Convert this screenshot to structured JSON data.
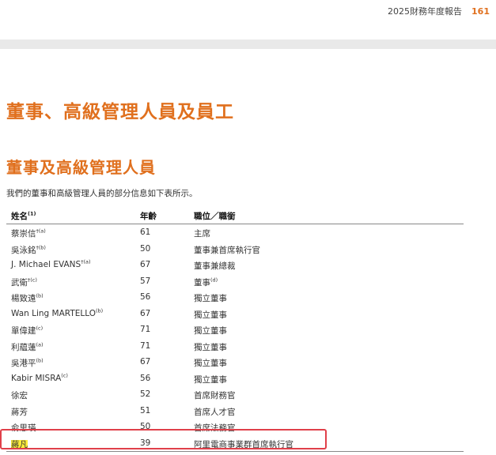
{
  "header": {
    "report_title": "2025財務年度報告",
    "page_number": "161"
  },
  "section_title": "董事、高級管理人員及員工",
  "subsection_title": "董事及高級管理人員",
  "intro_text": "我們的董事和高級管理人員的部分信息如下表所示。",
  "table": {
    "headers": {
      "name": "姓名",
      "name_note": "(1)",
      "age": "年齡",
      "position": "職位／職銜"
    },
    "rows": [
      {
        "name": "蔡崇信",
        "note": "†(a)",
        "age": "61",
        "position": "主席",
        "pos_note": ""
      },
      {
        "name": "吳泳銘",
        "note": "†(b)",
        "age": "50",
        "position": "董事兼首席執行官",
        "pos_note": ""
      },
      {
        "name": "J. Michael EVANS",
        "note": "†(a)",
        "age": "67",
        "position": "董事兼總裁",
        "pos_note": ""
      },
      {
        "name": "武衛",
        "note": "†(c)",
        "age": "57",
        "position": "董事",
        "pos_note": "(d)"
      },
      {
        "name": "楊致遠",
        "note": "(b)",
        "age": "56",
        "position": "獨立董事",
        "pos_note": ""
      },
      {
        "name": "Wan Ling MARTELLO",
        "note": "(b)",
        "age": "67",
        "position": "獨立董事",
        "pos_note": ""
      },
      {
        "name": "單偉建",
        "note": "(c)",
        "age": "71",
        "position": "獨立董事",
        "pos_note": ""
      },
      {
        "name": "利蘊蓮",
        "note": "(a)",
        "age": "71",
        "position": "獨立董事",
        "pos_note": ""
      },
      {
        "name": "吳港平",
        "note": "(b)",
        "age": "67",
        "position": "獨立董事",
        "pos_note": ""
      },
      {
        "name": "Kabir MISRA",
        "note": "(c)",
        "age": "56",
        "position": "獨立董事",
        "pos_note": ""
      },
      {
        "name": "徐宏",
        "note": "",
        "age": "52",
        "position": "首席財務官",
        "pos_note": ""
      },
      {
        "name": "蔣芳",
        "note": "",
        "age": "51",
        "position": "首席人才官",
        "pos_note": ""
      },
      {
        "name": "俞思瑛",
        "note": "",
        "age": "50",
        "position": "首席法務官",
        "pos_note": ""
      },
      {
        "name": "蔣凡",
        "note": "",
        "age": "39",
        "position": "阿里電商事業群首席執行官",
        "pos_note": ""
      }
    ]
  },
  "colors": {
    "accent": "#e0701e",
    "highlight_border": "#e0404a",
    "highlight_fill": "#ffef3a"
  }
}
